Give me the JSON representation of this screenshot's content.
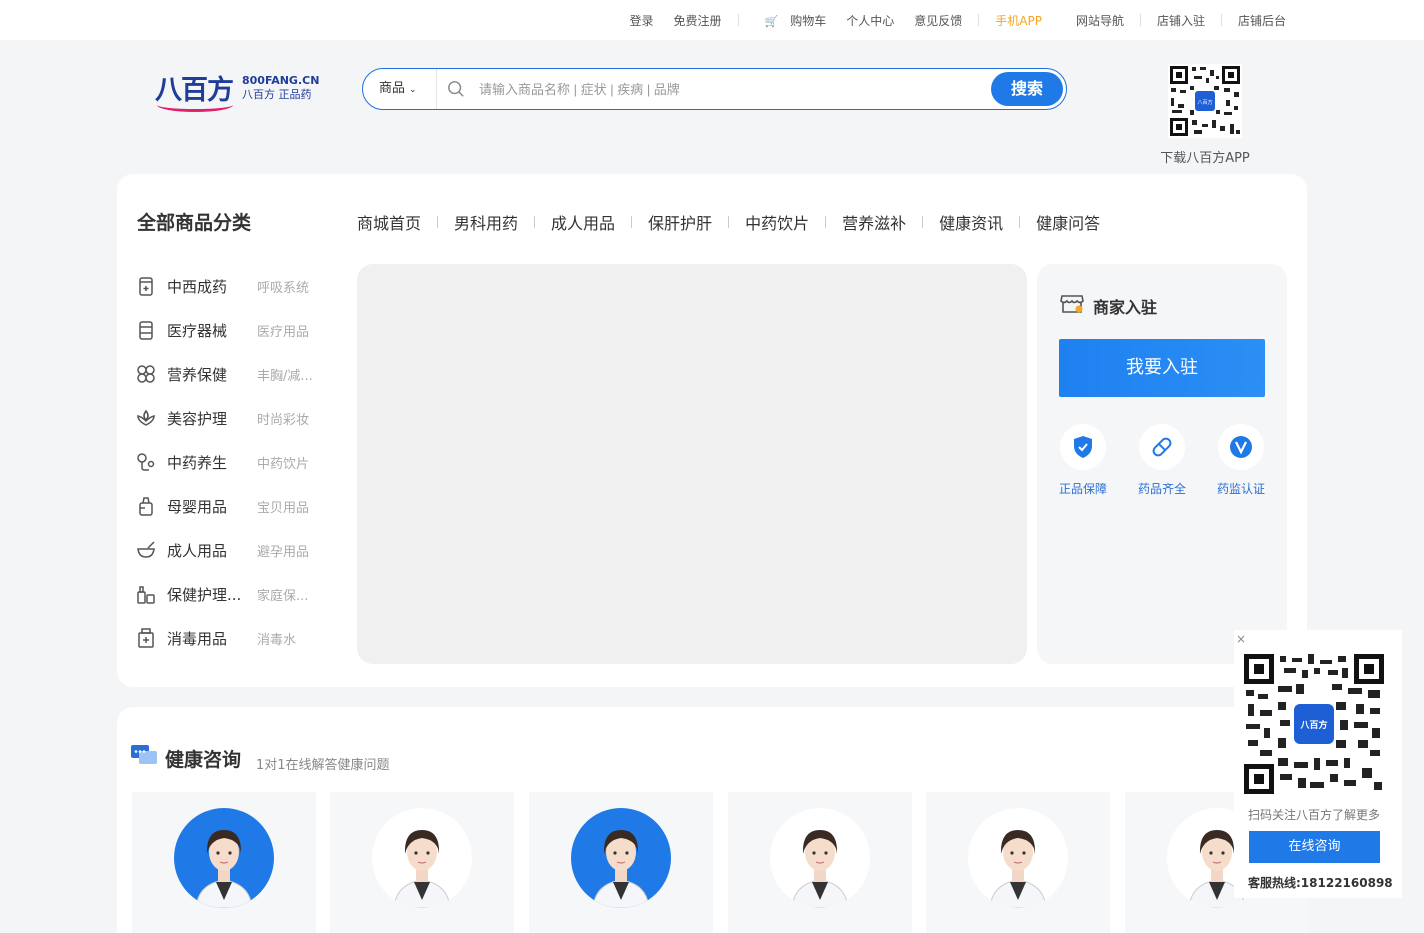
{
  "topbar": {
    "login": "登录",
    "register": "免费注册",
    "cart": "购物车",
    "profile": "个人中心",
    "feedback": "意见反馈",
    "mobile_app": "手机APP",
    "site_nav": "网站导航",
    "store_join": "店铺入驻",
    "store_admin": "店铺后台"
  },
  "logo": {
    "mark": "八百方",
    "domain": "800FANG.CN",
    "slogan": "八百方 正品药"
  },
  "search": {
    "category": "商品",
    "placeholder": "请输入商品名称 | 症状 | 疾病 | 品牌",
    "button": "搜索"
  },
  "app_download": {
    "label": "下载八百方APP"
  },
  "main": {
    "all_categories": "全部商品分类",
    "nav": [
      "商城首页",
      "男科用药",
      "成人用品",
      "保肝护肝",
      "中药饮片",
      "营养滋补",
      "健康资讯",
      "健康问答"
    ],
    "categories": [
      {
        "name": "中西成药",
        "sub": "呼吸系统",
        "icon": "medicine-bottle-icon"
      },
      {
        "name": "医疗器械",
        "sub": "医疗用品",
        "icon": "device-icon"
      },
      {
        "name": "营养保健",
        "sub": "丰胸/减...",
        "icon": "nutrition-icon"
      },
      {
        "name": "美容护理",
        "sub": "时尚彩妆",
        "icon": "beauty-icon"
      },
      {
        "name": "中药养生",
        "sub": "中药饮片",
        "icon": "herb-icon"
      },
      {
        "name": "母婴用品",
        "sub": "宝贝用品",
        "icon": "baby-bottle-icon"
      },
      {
        "name": "成人用品",
        "sub": "避孕用品",
        "icon": "bowl-icon"
      },
      {
        "name": "保健护理...",
        "sub": "家庭保...",
        "icon": "care-icon"
      },
      {
        "name": "消毒用品",
        "sub": "消毒水",
        "icon": "disinfect-icon"
      }
    ]
  },
  "merchant": {
    "title": "商家入驻",
    "join_button": "我要入驻",
    "features": [
      {
        "label": "正品保障",
        "icon": "shield-icon"
      },
      {
        "label": "药品齐全",
        "icon": "pill-icon"
      },
      {
        "label": "药监认证",
        "icon": "verified-icon"
      }
    ]
  },
  "consult": {
    "title": "健康咨询",
    "subtitle": "1对1在线解答健康问题"
  },
  "float_qr": {
    "close": "×",
    "scan_text": "扫码关注八百方了解更多",
    "button": "在线咨询",
    "hotline": "客服热线:18122160898"
  },
  "colors": {
    "brand_blue": "#1f7ae8",
    "accent_orange": "#f5a623",
    "logo_pink": "#e0206a"
  }
}
